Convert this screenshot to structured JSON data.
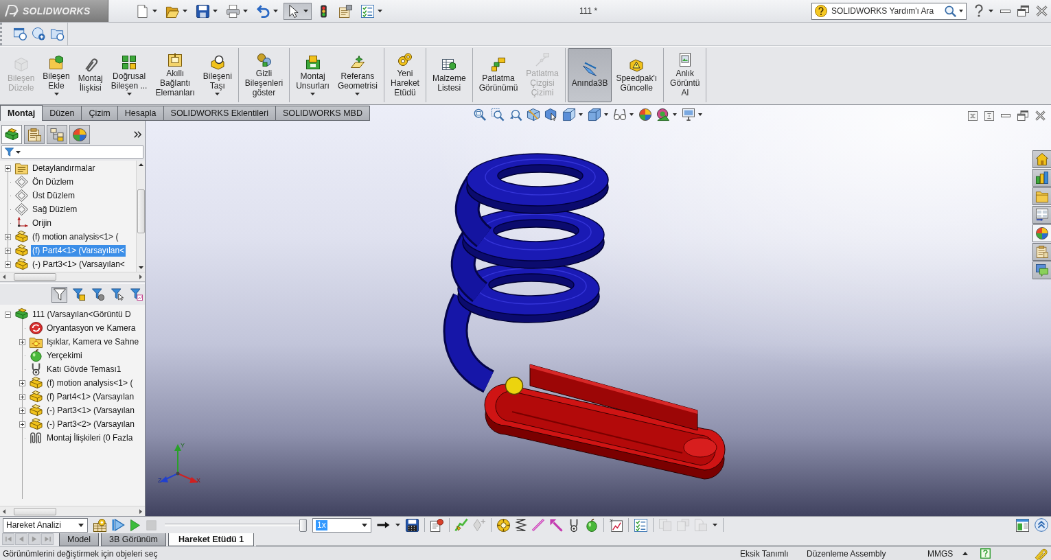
{
  "title_bar": {
    "logo": "SOLIDWORKS",
    "quick_access": [
      {
        "dropdown": true,
        "selected": false
      },
      {
        "dropdown": true,
        "selected": false
      },
      {
        "dropdown": true,
        "selected": false
      },
      {
        "dropdown": true,
        "selected": false
      },
      {
        "dropdown": true,
        "selected": false
      },
      {
        "dropdown": true,
        "selected": true
      },
      {
        "dropdown": false,
        "selected": false
      },
      {
        "dropdown": false,
        "selected": false
      },
      {
        "dropdown": true,
        "selected": false
      }
    ],
    "document_title": "111 *",
    "help_search": {
      "placeholder": "SOLIDWORKS Yardım'ı Ara"
    }
  },
  "command_manager": {
    "groups": [
      {
        "buttons": [
          {
            "label": "Bileşen\nDüzele",
            "disabled": true,
            "selected": false,
            "dropdown": false
          },
          {
            "label": "Bileşen\nEkle",
            "disabled": false,
            "selected": false,
            "dropdown": true
          },
          {
            "label": "Montaj\nİlişkisi",
            "disabled": false,
            "selected": false,
            "dropdown": false
          },
          {
            "label": "Doğrusal\nBileşen ...",
            "disabled": false,
            "selected": false,
            "dropdown": true
          },
          {
            "label": "Akıllı\nBağlantı\nElemanları",
            "disabled": false,
            "selected": false,
            "dropdown": false
          },
          {
            "label": "Bileşeni\nTaşı",
            "disabled": false,
            "selected": false,
            "dropdown": true
          }
        ]
      },
      {
        "buttons": [
          {
            "label": "Gizli\nBileşenleri\ngöster",
            "disabled": false,
            "selected": false,
            "dropdown": false
          }
        ]
      },
      {
        "buttons": [
          {
            "label": "Montaj\nUnsurları",
            "disabled": false,
            "selected": false,
            "dropdown": true
          },
          {
            "label": "Referans\nGeometrisi",
            "disabled": false,
            "selected": false,
            "dropdown": true
          }
        ]
      },
      {
        "buttons": [
          {
            "label": "Yeni\nHareket\nEtüdü",
            "disabled": false,
            "selected": false,
            "dropdown": false
          }
        ]
      },
      {
        "buttons": [
          {
            "label": "Malzeme\nListesi",
            "disabled": false,
            "selected": false,
            "dropdown": false
          }
        ]
      },
      {
        "buttons": [
          {
            "label": "Patlatma\nGörünümü",
            "disabled": false,
            "selected": false,
            "dropdown": false
          },
          {
            "label": "Patlatma\nÇizgisi\nÇizimi",
            "disabled": true,
            "selected": false,
            "dropdown": false
          }
        ]
      },
      {
        "buttons": [
          {
            "label": "Anında3B",
            "disabled": false,
            "selected": true,
            "dropdown": false
          },
          {
            "label": "Speedpak'ı\nGüncelle",
            "disabled": false,
            "selected": false,
            "dropdown": false
          }
        ]
      },
      {
        "buttons": [
          {
            "label": "Anlık\nGörüntü\nAl",
            "disabled": false,
            "selected": false,
            "dropdown": false
          }
        ]
      }
    ],
    "tabs": [
      {
        "label": "Montaj",
        "selected": true
      },
      {
        "label": "Düzen",
        "selected": false
      },
      {
        "label": "Çizim",
        "selected": false
      },
      {
        "label": "Hesapla",
        "selected": false
      },
      {
        "label": "SOLIDWORKS Eklentileri",
        "selected": false
      },
      {
        "label": "SOLIDWORKS MBD",
        "selected": false
      }
    ]
  },
  "feature_manager": {
    "panel_tabs": [
      {
        "selected": true
      },
      {
        "selected": false
      },
      {
        "selected": false
      },
      {
        "selected": false
      }
    ],
    "top_tree": [
      {
        "label": "Detaylandırmalar",
        "kind": "annotations",
        "expanded": false,
        "selected": false
      },
      {
        "label": "Ön Düzlem",
        "kind": "plane",
        "selected": false
      },
      {
        "label": "Üst Düzlem",
        "kind": "plane",
        "selected": false
      },
      {
        "label": "Sağ Düzlem",
        "kind": "plane",
        "selected": false
      },
      {
        "label": "Orijin",
        "kind": "origin",
        "selected": false
      },
      {
        "label": "(f) motion analysis<1> (",
        "kind": "component",
        "expanded": false,
        "selected": false
      },
      {
        "label": "(f) Part4<1> (Varsayılan<",
        "kind": "component",
        "expanded": false,
        "selected": true
      },
      {
        "label": "(-) Part3<1> (Varsayılan<",
        "kind": "component",
        "expanded": false,
        "selected": false
      }
    ],
    "filters": [
      {
        "selected": true
      },
      {
        "selected": false
      },
      {
        "selected": false
      },
      {
        "selected": false
      },
      {
        "selected": false
      }
    ],
    "tree": [
      {
        "label": "111 (Varsayılan<Görüntü D",
        "kind": "assembly",
        "expanded": true,
        "selected": false,
        "children": [
          {
            "label": "Oryantasyon ve Kamera",
            "kind": "orientation",
            "selected": false
          },
          {
            "label": "Işıklar, Kamera ve Sahne",
            "kind": "lights",
            "expanded": false,
            "selected": false
          },
          {
            "label": "Yerçekimi",
            "kind": "gravity",
            "selected": false
          },
          {
            "label": "Katı Gövde Teması1",
            "kind": "contact",
            "selected": false
          },
          {
            "label": "(f) motion analysis<1> (",
            "kind": "component",
            "expanded": false,
            "selected": false
          },
          {
            "label": "(f) Part4<1> (Varsayılan",
            "kind": "component",
            "expanded": false,
            "selected": false
          },
          {
            "label": "(-) Part3<1> (Varsayılan",
            "kind": "component",
            "expanded": false,
            "selected": false
          },
          {
            "label": "(-) Part3<2> (Varsayılan",
            "kind": "component",
            "expanded": false,
            "selected": false
          },
          {
            "label": "Montaj İlişkileri (0 Fazla",
            "kind": "mates",
            "selected": false
          }
        ]
      }
    ]
  },
  "viewport": {
    "axis_labels": [
      "Y",
      "Z",
      "X"
    ],
    "task_pane_tabs": [
      {
        "selected": false
      },
      {
        "selected": false
      },
      {
        "selected": false
      },
      {
        "selected": false
      },
      {
        "selected": true
      },
      {
        "selected": false
      },
      {
        "selected": false
      }
    ]
  },
  "motion_manager": {
    "study_type": "Hareket Analizi",
    "time_slider": {
      "level": 1
    },
    "playback_speed": "1x",
    "tabs": [
      {
        "label": "Model",
        "selected": false
      },
      {
        "label": "3B Görünüm",
        "selected": false
      },
      {
        "label": "Hareket Etüdü 1",
        "selected": true
      }
    ]
  },
  "status_bar": {
    "message": "Görünümlerini değiştirmek için objeleri seç",
    "fields": [
      "Eksik Tanımlı",
      "Düzenleme Assembly",
      "MMGS"
    ]
  }
}
